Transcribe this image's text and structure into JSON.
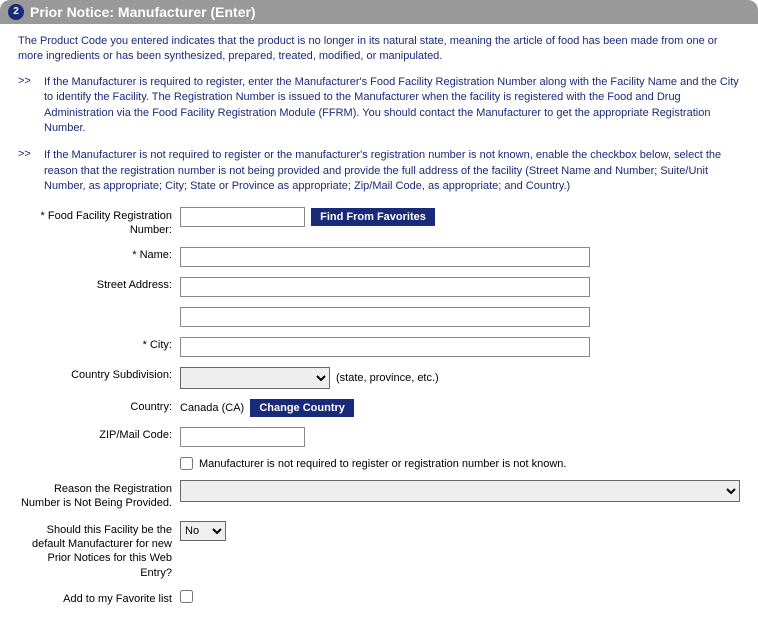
{
  "header": {
    "step": "2",
    "title": "Prior Notice: Manufacturer (Enter)"
  },
  "intro": "The Product Code you entered indicates that the product is no longer in its natural state, meaning the article of food has been made from one or more ingredients or has been synthesized, prepared, treated, modified, or manipulated.",
  "bullets": {
    "marker": ">>",
    "b1": "If the Manufacturer is required to register, enter the Manufacturer's Food Facility Registration Number along with the Facility Name and the City to identify the Facility. The Registration Number is issued to the Manufacturer when the facility is registered with the Food and Drug Administration via the Food Facility Registration Module (FFRM). You should contact the Manufacturer to get the appropriate Registration Number.",
    "b2": "If the Manufacturer is not required to register or the manufacturer's registration number is not known, enable the checkbox below, select the reason that the registration number is not being provided and provide the full address of the facility (Street Name and Number; Suite/Unit Number, as appropriate; City; State or Province as appropriate; Zip/Mail Code, as appropriate; and Country.)"
  },
  "form": {
    "reg_label": "* Food Facility Registration Number:",
    "reg_value": "",
    "find_favorites_label": "Find From Favorites",
    "name_label": "* Name:",
    "name_value": "",
    "street_label": "Street Address:",
    "street1_value": "",
    "street2_value": "",
    "city_label": "* City:",
    "city_value": "",
    "subdiv_label": "Country Subdivision:",
    "subdiv_hint": "(state, province, etc.)",
    "country_label": "Country:",
    "country_value": "Canada (CA)",
    "change_country_label": "Change Country",
    "zip_label": "ZIP/Mail Code:",
    "zip_value": "",
    "not_required_label": "Manufacturer is not required to register or registration number is not known.",
    "reason_label": "Reason the Registration Number is Not Being Provided.",
    "default_label": "Should this Facility be the default Manufacturer for new Prior Notices for this Web Entry?",
    "default_value": "No",
    "favorite_label": "Add to my Favorite list"
  }
}
